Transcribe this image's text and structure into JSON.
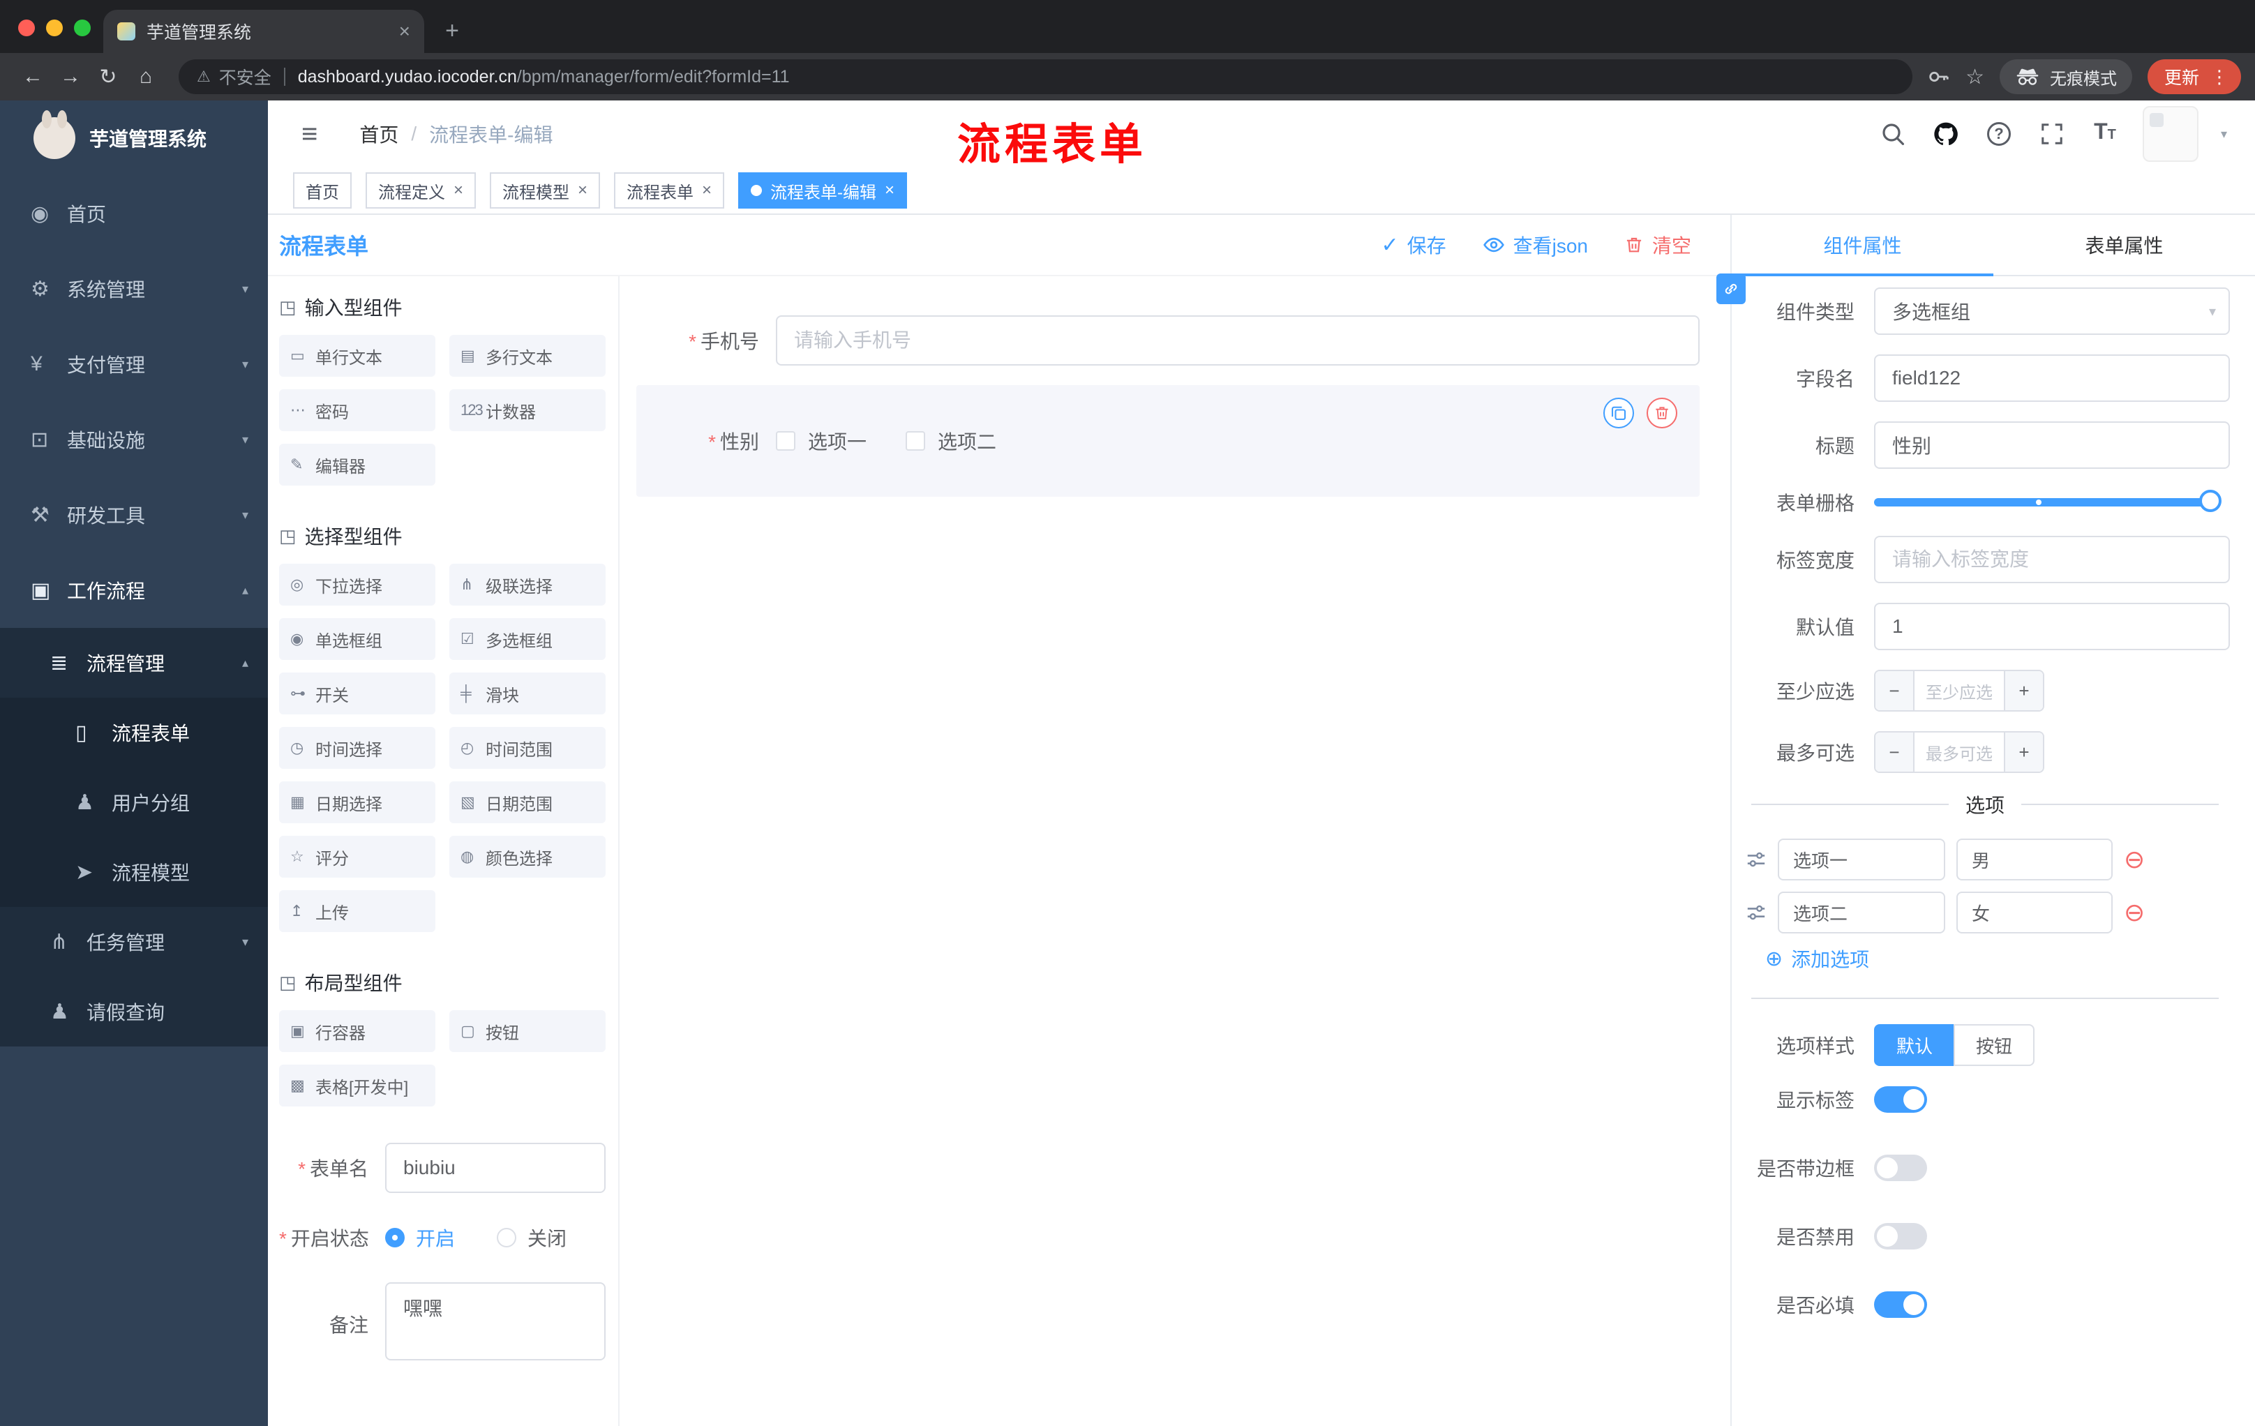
{
  "colors": {
    "primary": "#409EFF",
    "danger": "#F56C6C",
    "sidebar": "#304156",
    "submenu": "#1F2D3D",
    "tag_active": "#409EFF",
    "annotation": "#FB0B0B"
  },
  "icons": {
    "back": "←",
    "forward": "→",
    "reload": "↻",
    "home": "⌂",
    "warning": "⚠",
    "star": "☆",
    "dots": "⋮",
    "plus": "+",
    "close": "×",
    "hamburger": "≡",
    "question": "?",
    "font_big": "T",
    "font_small": "T",
    "menu_home": "◉",
    "gear": "⚙",
    "yen": "¥",
    "infra": "⊡",
    "tools": "⚒",
    "workflow": "▣",
    "list": "≣",
    "doc": "▯",
    "users": "♟",
    "send": "➤",
    "tasks": "⋔",
    "person": "♟",
    "chev_down": "▾",
    "chev_up": "▴",
    "section": "◳",
    "check": "✓",
    "minus": "−",
    "minus_circle": "⊖",
    "plus_circle": "⊕"
  },
  "browser": {
    "tab_title": "芋道管理系统",
    "security_label": "不安全",
    "url_host": "dashboard.yudao.iocoder.cn",
    "url_path": "/bpm/manager/form/edit?formId=11",
    "incognito_label": "无痕模式",
    "update_label": "更新"
  },
  "sidebar": {
    "logo_title": "芋道管理系统",
    "menu": {
      "home": "首页",
      "system": "系统管理",
      "payment": "支付管理",
      "infra": "基础设施",
      "devtools": "研发工具",
      "workflow": "工作流程",
      "process_manage": "流程管理",
      "process_form": "流程表单",
      "user_group": "用户分组",
      "process_model": "流程模型",
      "task_manage": "任务管理",
      "leave_query": "请假查询"
    }
  },
  "navbar": {
    "breadcrumb_home": "首页",
    "breadcrumb_sep": "/",
    "breadcrumb_current": "流程表单-编辑",
    "annotation": "流程表单"
  },
  "tags": {
    "items": [
      {
        "label": "首页",
        "closable": false,
        "active": false
      },
      {
        "label": "流程定义",
        "closable": true,
        "active": false
      },
      {
        "label": "流程模型",
        "closable": true,
        "active": false
      },
      {
        "label": "流程表单",
        "closable": true,
        "active": false
      },
      {
        "label": "流程表单-编辑",
        "closable": true,
        "active": true
      }
    ]
  },
  "designer": {
    "title": "流程表单",
    "save": "保存",
    "view_json": "查看json",
    "clear": "清空",
    "palette": {
      "sections": [
        {
          "title": "输入型组件",
          "items": [
            {
              "label": "单行文本",
              "icon": "▭"
            },
            {
              "label": "多行文本",
              "icon": "▤"
            },
            {
              "label": "密码",
              "icon": "⋯"
            },
            {
              "label": "计数器",
              "icon": "123"
            },
            {
              "label": "编辑器",
              "icon": "✎"
            }
          ]
        },
        {
          "title": "选择型组件",
          "items": [
            {
              "label": "下拉选择",
              "icon": "◎"
            },
            {
              "label": "级联选择",
              "icon": "⋔"
            },
            {
              "label": "单选框组",
              "icon": "◉"
            },
            {
              "label": "多选框组",
              "icon": "☑"
            },
            {
              "label": "开关",
              "icon": "⊶"
            },
            {
              "label": "滑块",
              "icon": "╪"
            },
            {
              "label": "时间选择",
              "icon": "◷"
            },
            {
              "label": "时间范围",
              "icon": "◴"
            },
            {
              "label": "日期选择",
              "icon": "▦"
            },
            {
              "label": "日期范围",
              "icon": "▧"
            },
            {
              "label": "评分",
              "icon": "☆"
            },
            {
              "label": "颜色选择",
              "icon": "◍"
            },
            {
              "label": "上传",
              "icon": "↥"
            }
          ]
        },
        {
          "title": "布局型组件",
          "items": [
            {
              "label": "行容器",
              "icon": "▣"
            },
            {
              "label": "按钮",
              "icon": "▢"
            },
            {
              "label": "表格[开发中]",
              "icon": "▩"
            }
          ]
        }
      ]
    },
    "form": {
      "name_label": "表单名",
      "name_value": "biubiu",
      "status_label": "开启状态",
      "status_on": "开启",
      "status_off": "关闭",
      "remark_label": "备注",
      "remark_value": "嘿嘿"
    },
    "canvas": {
      "phone_label": "手机号",
      "phone_placeholder": "请输入手机号",
      "gender_label": "性别",
      "gender_option1": "选项一",
      "gender_option2": "选项二"
    }
  },
  "props": {
    "tab_component": "组件属性",
    "tab_form": "表单属性",
    "component_type_label": "组件类型",
    "component_type_value": "多选框组",
    "field_name_label": "字段名",
    "field_name_value": "field122",
    "title_label": "标题",
    "title_value": "性别",
    "grid_label": "表单栅格",
    "label_width_label": "标签宽度",
    "label_width_placeholder": "请输入标签宽度",
    "default_label": "默认值",
    "default_value": "1",
    "min_label": "至少应选",
    "min_placeholder": "至少应选",
    "max_label": "最多可选",
    "max_placeholder": "最多可选",
    "options_title": "选项",
    "options": [
      {
        "name": "选项一",
        "value": "男"
      },
      {
        "name": "选项二",
        "value": "女"
      }
    ],
    "add_option": "添加选项",
    "style_label": "选项样式",
    "style_default": "默认",
    "style_button": "按钮",
    "show_label": "显示标签",
    "border_label": "是否带边框",
    "disabled_label": "是否禁用",
    "required_label": "是否必填"
  }
}
